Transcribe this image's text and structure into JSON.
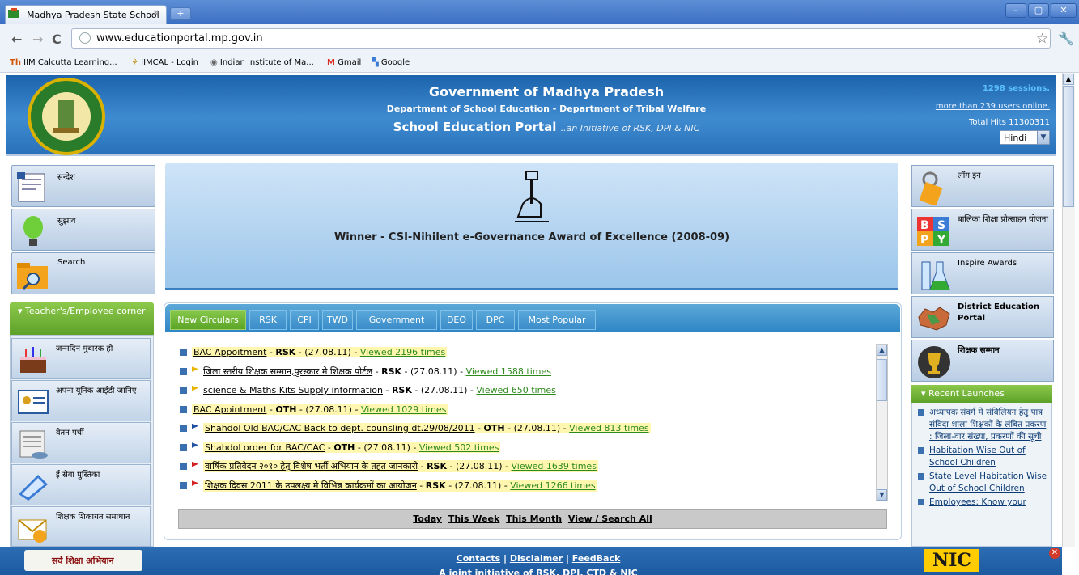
{
  "browser": {
    "tab_title": "Madhya Pradesh State School",
    "url": "www.educationportal.mp.gov.in",
    "bookmarks": [
      "IIM Calcutta Learning...",
      "IIMCAL - Login",
      "Indian Institute of Ma...",
      "Gmail",
      "Google"
    ]
  },
  "header": {
    "line1": "Government of Madhya Pradesh",
    "line2": "Department of School Education - Department of Tribal Welfare",
    "line3_main": "School Education Portal",
    "line3_sub": "..an Initiative of RSK, DPI & NIC",
    "sessions": "1298 sessions.",
    "users_online": "more than 239 users online.",
    "total_hits": "Total Hits 11300311",
    "language": "Hindi"
  },
  "left_menu": [
    {
      "label": "सन्देश"
    },
    {
      "label": "सुझाव"
    },
    {
      "label": "Search"
    }
  ],
  "teacher_corner": {
    "title": "Teacher's/Employee corner",
    "items": [
      {
        "label": "जन्मदिन मुबारक हो"
      },
      {
        "label": "अपना यूनिक आईडी जानिए"
      },
      {
        "label": "वेतन पर्ची"
      },
      {
        "label": "ई सेवा पुस्तिका"
      },
      {
        "label": "शिक्षक शिकायत समाधान"
      }
    ]
  },
  "award": {
    "text": "Winner - CSI-Nihilent e-Governance Award of Excellence (2008-09)"
  },
  "circular_tabs": [
    "New Circulars",
    "RSK",
    "CPI",
    "TWD",
    "Government",
    "DEO",
    "DPC",
    "Most Popular"
  ],
  "circulars": [
    {
      "title": "BAC Appoitment",
      "dept": "RSK",
      "date": "(27.08.11)",
      "views": "Viewed 2196 times",
      "flag": "",
      "hl": true
    },
    {
      "title": "जिला स्तरीय शिक्षक सम्मान,पुरस्कार मे शिक्षक पोर्टल",
      "dept": "RSK",
      "date": "(27.08.11)",
      "views": "Viewed 1588 times",
      "flag": "#e8b400",
      "hl": false
    },
    {
      "title": "science & Maths Kits Supply information",
      "dept": "RSK",
      "date": "(27.08.11)",
      "views": "Viewed 650 times",
      "flag": "#e8b400",
      "hl": false
    },
    {
      "title": "BAC Apointment",
      "dept": "OTH",
      "date": "(27.08.11)",
      "views": "Viewed 1029 times",
      "flag": "",
      "hl": true
    },
    {
      "title": "Shahdol Old BAC/CAC Back to dept. counsling dt.29/08/2011",
      "dept": "OTH",
      "date": "(27.08.11)",
      "views": "Viewed 813 times",
      "flag": "#1f4fa0",
      "hl": true
    },
    {
      "title": "Shahdol order for BAC/CAC",
      "dept": "OTH",
      "date": "(27.08.11)",
      "views": "Viewed 502 times",
      "flag": "#1f4fa0",
      "hl": true
    },
    {
      "title": "वार्षिक प्रतिवेदन २०१० हेतु विशेष भर्ती अभियान के तहत जानकारी",
      "dept": "RSK",
      "date": "(27.08.11)",
      "views": "Viewed 1639 times",
      "flag": "#d42020",
      "hl": true
    },
    {
      "title": "शिक्षक दिवस 2011 के उपलक्ष्य मे विभिन्न कार्यक्रमों का आयोजन",
      "dept": "RSK",
      "date": "(27.08.11)",
      "views": "Viewed 1266 times",
      "flag": "#d42020",
      "hl": true
    }
  ],
  "filter": [
    "Today",
    "This Week",
    "This Month",
    "View / Search All"
  ],
  "right_menu": [
    {
      "label": "लॉग इन"
    },
    {
      "label": "बालिका शिक्षा प्रोत्साहन योजना"
    },
    {
      "label": "Inspire Awards"
    },
    {
      "label": "District Education Portal"
    },
    {
      "label": "शिक्षक सम्मान"
    }
  ],
  "recent": {
    "title": "Recent Launches",
    "items": [
      "अध्यापक संवर्ग में संविलियन हेतु पात्र संविदा शाला शिक्षकों के लंबित प्रकरण : जिला-वार संख्या, प्रकरणों की सूची",
      "Habitation Wise Out of School Children",
      "State Level Habitation Wise Out of School Children",
      "Employees: Know your"
    ]
  },
  "footer": {
    "contacts": "Contacts",
    "disclaimer": "Disclaimer",
    "feedback": "FeedBack",
    "joint": "A joint initiative of RSK, DPI, CTD & NIC",
    "ss_logo": "सर्व शिक्षा अभियान",
    "nic": "NIC"
  }
}
